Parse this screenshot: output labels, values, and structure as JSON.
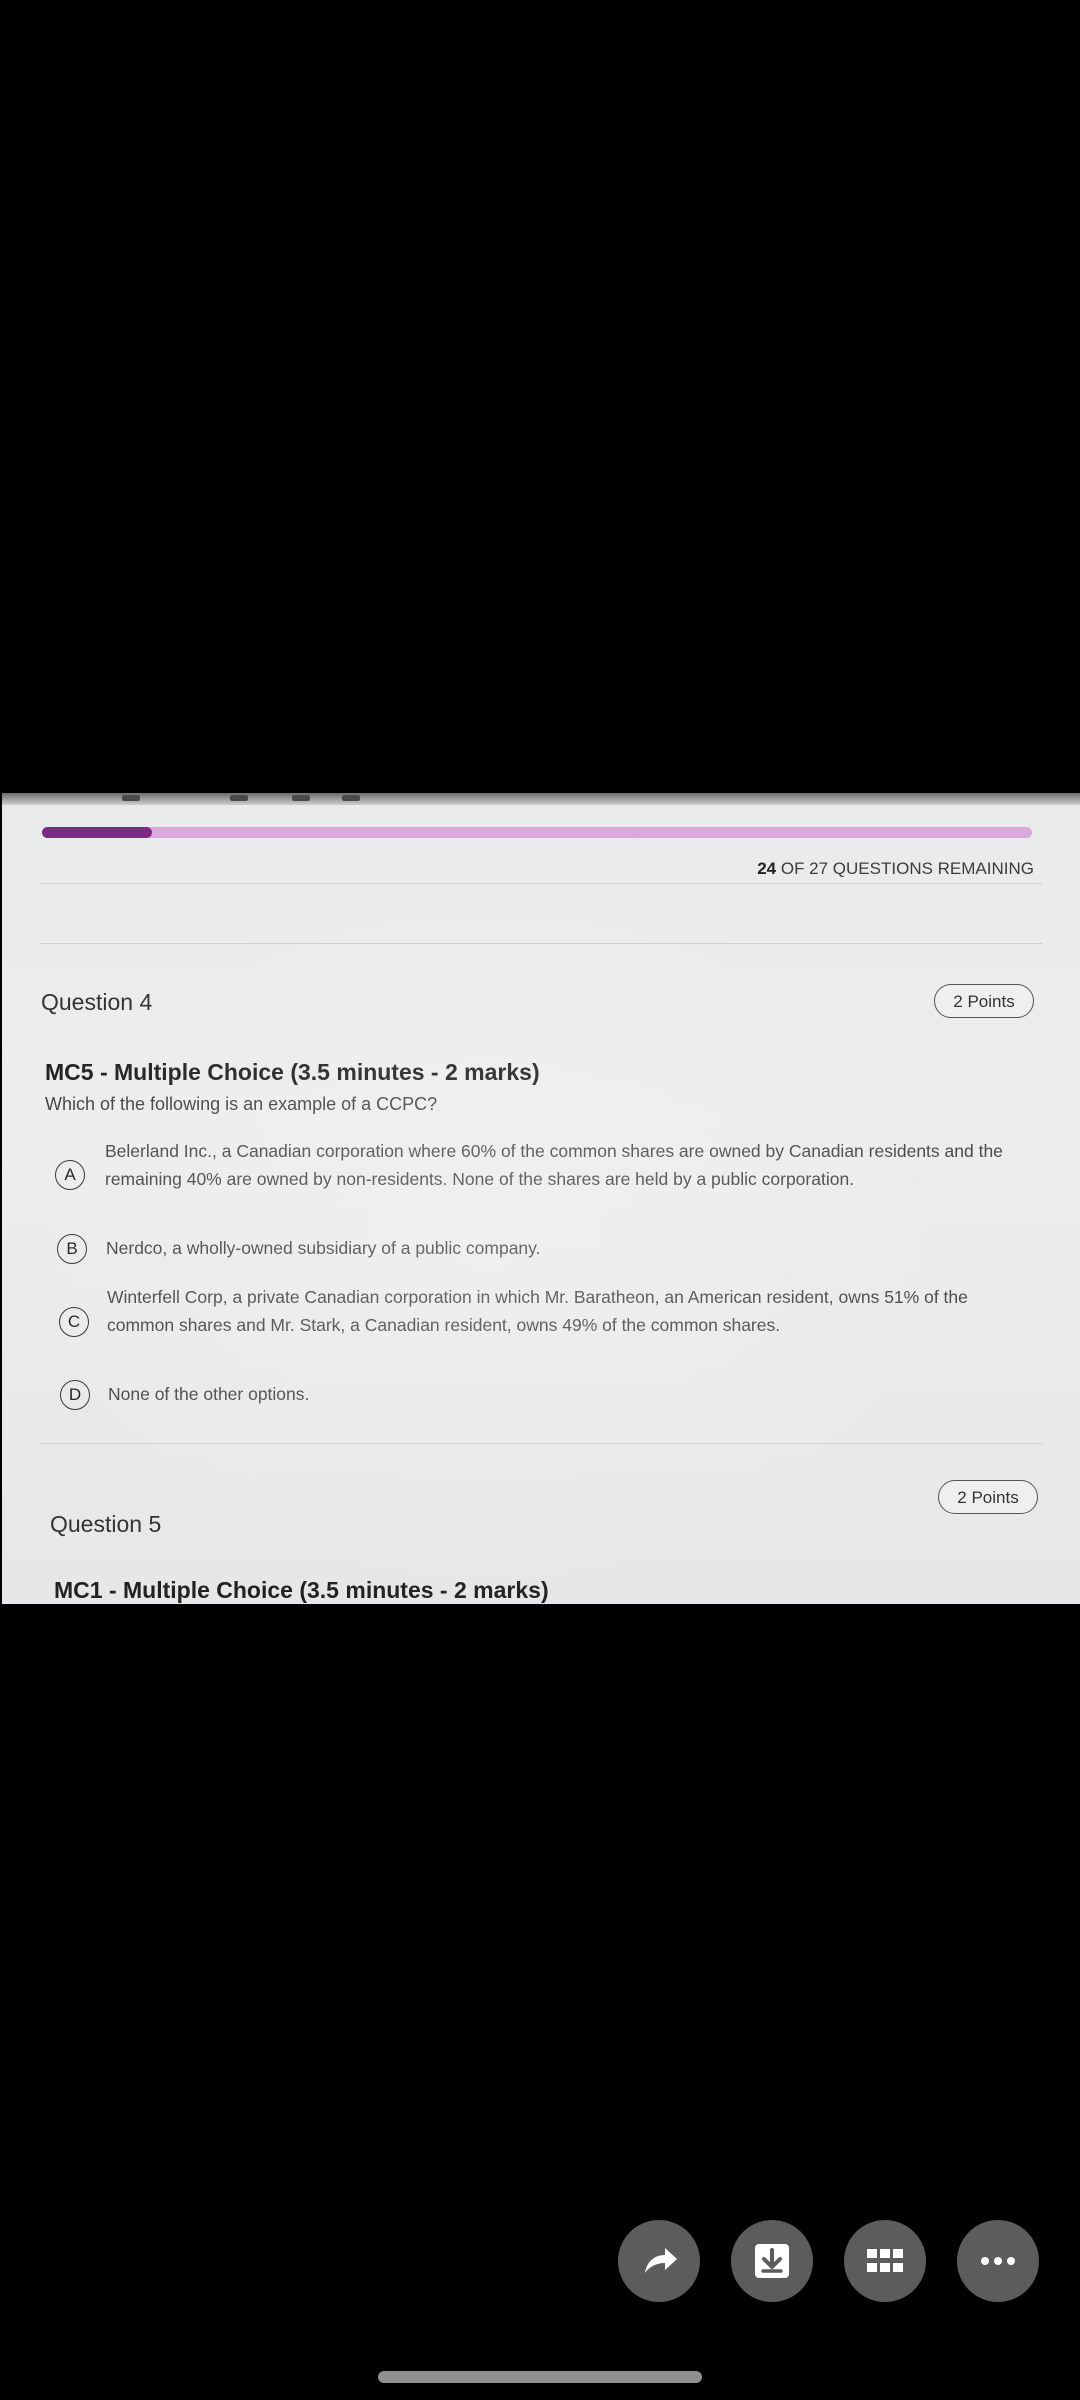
{
  "progress": {
    "fraction_complete": 0.111,
    "remaining_count": "24",
    "remaining_suffix": " OF 27 QUESTIONS REMAINING"
  },
  "question4": {
    "label": "Question 4",
    "points": "2 Points",
    "heading": "MC5 - Multiple Choice (3.5 minutes - 2 marks)",
    "prompt": "Which of the following is an example of a CCPC?",
    "options": [
      {
        "letter": "A",
        "text": "Belerland Inc., a Canadian corporation where 60% of the common shares are owned by Canadian residents and the remaining 40% are owned by non-residents. None of the shares are held by a public corporation."
      },
      {
        "letter": "B",
        "text": "Nerdco, a wholly-owned subsidiary of a public company."
      },
      {
        "letter": "C",
        "text": "Winterfell Corp, a private Canadian corporation in which Mr. Baratheon, an American resident, owns 51% of the common shares and Mr. Stark, a Canadian resident, owns 49% of the common shares."
      },
      {
        "letter": "D",
        "text": "None of the other options."
      }
    ]
  },
  "question5": {
    "label": "Question 5",
    "points": "2 Points",
    "heading": "MC1 - Multiple Choice (3.5 minutes - 2 marks)"
  },
  "actions": {
    "icons": [
      "share-icon",
      "download-icon",
      "grid-icon",
      "more-icon"
    ]
  }
}
